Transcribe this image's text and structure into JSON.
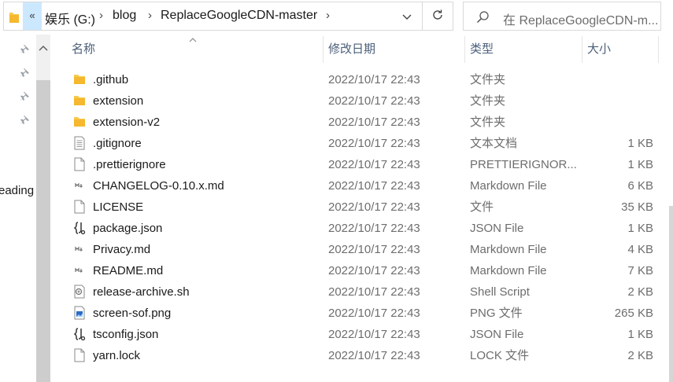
{
  "address_bar": {
    "overflow_label": "«",
    "breadcrumbs": [
      {
        "label": "娱乐 (G:)"
      },
      {
        "label": "blog"
      },
      {
        "label": "ReplaceGoogleCDN-master"
      }
    ],
    "separator": "›"
  },
  "search": {
    "placeholder": "在 ReplaceGoogleCDN-m..."
  },
  "nav_pane": {
    "partial_label": "eading"
  },
  "columns": {
    "name": "名称",
    "date": "修改日期",
    "type": "类型",
    "size": "大小"
  },
  "files": [
    {
      "name": ".github",
      "date": "2022/10/17 22:43",
      "type": "文件夹",
      "size": "",
      "icon": "folder-icon"
    },
    {
      "name": "extension",
      "date": "2022/10/17 22:43",
      "type": "文件夹",
      "size": "",
      "icon": "folder-icon"
    },
    {
      "name": "extension-v2",
      "date": "2022/10/17 22:43",
      "type": "文件夹",
      "size": "",
      "icon": "folder-icon"
    },
    {
      "name": ".gitignore",
      "date": "2022/10/17 22:43",
      "type": "文本文档",
      "size": "1 KB",
      "icon": "text-document-icon"
    },
    {
      "name": ".prettierignore",
      "date": "2022/10/17 22:43",
      "type": "PRETTIERIGNOR...",
      "size": "1 KB",
      "icon": "blank-file-icon"
    },
    {
      "name": "CHANGELOG-0.10.x.md",
      "date": "2022/10/17 22:43",
      "type": "Markdown File",
      "size": "6 KB",
      "icon": "markdown-file-icon"
    },
    {
      "name": "LICENSE",
      "date": "2022/10/17 22:43",
      "type": "文件",
      "size": "35 KB",
      "icon": "blank-file-icon"
    },
    {
      "name": "package.json",
      "date": "2022/10/17 22:43",
      "type": "JSON File",
      "size": "1 KB",
      "icon": "json-file-icon"
    },
    {
      "name": "Privacy.md",
      "date": "2022/10/17 22:43",
      "type": "Markdown File",
      "size": "4 KB",
      "icon": "markdown-file-icon"
    },
    {
      "name": "README.md",
      "date": "2022/10/17 22:43",
      "type": "Markdown File",
      "size": "7 KB",
      "icon": "markdown-file-icon"
    },
    {
      "name": "release-archive.sh",
      "date": "2022/10/17 22:43",
      "type": "Shell Script",
      "size": "2 KB",
      "icon": "shell-script-icon"
    },
    {
      "name": "screen-sof.png",
      "date": "2022/10/17 22:43",
      "type": "PNG 文件",
      "size": "265 KB",
      "icon": "image-file-icon"
    },
    {
      "name": "tsconfig.json",
      "date": "2022/10/17 22:43",
      "type": "JSON File",
      "size": "1 KB",
      "icon": "json-file-icon"
    },
    {
      "name": "yarn.lock",
      "date": "2022/10/17 22:43",
      "type": "LOCK 文件",
      "size": "2 KB",
      "icon": "blank-file-icon"
    }
  ],
  "colors": {
    "folder": "#f8c94a",
    "selection": "#cce8ff",
    "header_text": "#4c607a",
    "secondary_text": "#6d6d6d"
  }
}
